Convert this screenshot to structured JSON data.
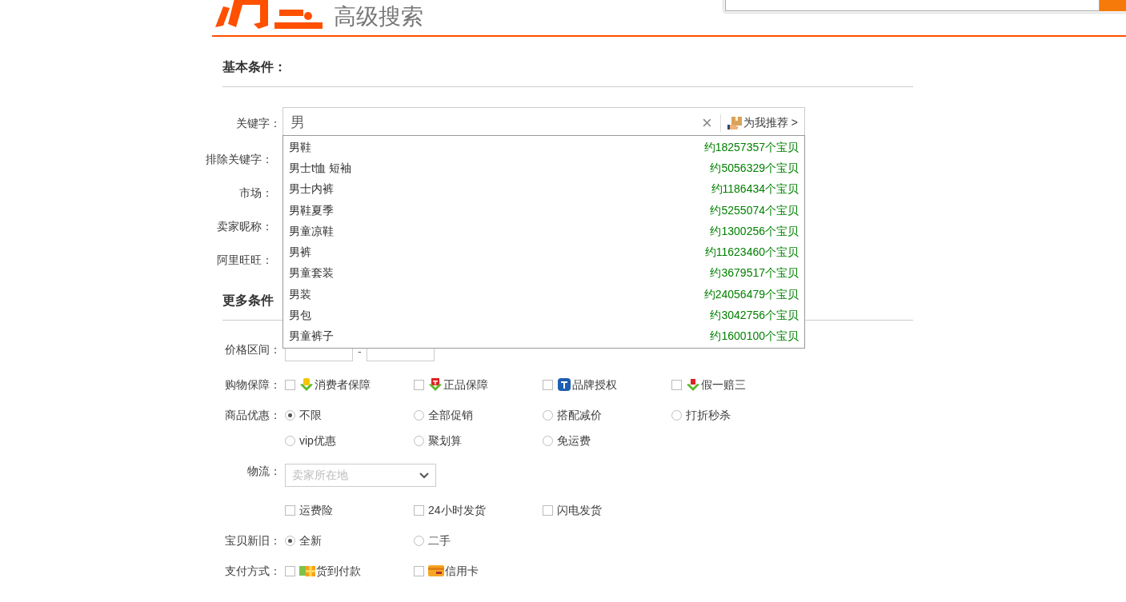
{
  "header": {
    "subtitle": "高级搜索"
  },
  "basic": {
    "title": "基本条件：",
    "keyword": {
      "label": "关键字：",
      "value": "男",
      "clear": "×",
      "recommend": "为我推荐 >"
    },
    "fields": [
      {
        "label": "排除关键字："
      },
      {
        "label": "市场："
      },
      {
        "label": "卖家昵称："
      },
      {
        "label": "阿里旺旺："
      }
    ]
  },
  "suggestions": [
    {
      "text": "男鞋",
      "count": "约18257357个宝贝"
    },
    {
      "text": "男士t恤 短袖",
      "count": "约5056329个宝贝"
    },
    {
      "text": "男士内裤",
      "count": "约1186434个宝贝"
    },
    {
      "text": "男鞋夏季",
      "count": "约5255074个宝贝"
    },
    {
      "text": "男童凉鞋",
      "count": "约1300256个宝贝"
    },
    {
      "text": "男裤",
      "count": "约11623460个宝贝"
    },
    {
      "text": "男童套装",
      "count": "约3679517个宝贝"
    },
    {
      "text": "男装",
      "count": "约24056479个宝贝"
    },
    {
      "text": "男包",
      "count": "约3042756个宝贝"
    },
    {
      "text": "男童裤子",
      "count": "约1600100个宝贝"
    }
  ],
  "more": {
    "title": "更多条件",
    "rows": [
      {
        "kind": "price",
        "label": "价格区间：",
        "separator": "-"
      },
      {
        "kind": "checkbox",
        "label": "购物保障：",
        "options": [
          {
            "text": "消费者保障",
            "checked": false,
            "kind": "shield"
          },
          {
            "text": "正品保障",
            "checked": false,
            "kind": "genuine"
          },
          {
            "text": "品牌授权",
            "checked": false,
            "kind": "brand"
          },
          {
            "text": "假一赔三",
            "checked": false,
            "kind": "real"
          }
        ]
      },
      {
        "kind": "radio",
        "label": "商品优惠：",
        "options": [
          {
            "text": "不限",
            "selected": true
          },
          {
            "text": "全部促销",
            "selected": false
          },
          {
            "text": "搭配减价",
            "selected": false
          },
          {
            "text": "打折秒杀",
            "selected": false
          },
          {
            "text": "vip优惠",
            "selected": false
          },
          {
            "text": "聚划算",
            "selected": false
          },
          {
            "text": "免运费",
            "selected": false
          }
        ]
      },
      {
        "kind": "select",
        "label": "物流：",
        "placeholder": "卖家所在地"
      },
      {
        "kind": "checkbox",
        "options": [
          {
            "text": "运费险",
            "checked": false
          },
          {
            "text": "24小时发货",
            "checked": false
          },
          {
            "text": "闪电发货",
            "checked": false
          }
        ]
      },
      {
        "kind": "radio",
        "label": "宝贝新旧：",
        "options": [
          {
            "text": "全新",
            "selected": true
          },
          {
            "text": "二手",
            "selected": false
          }
        ]
      },
      {
        "kind": "checkbox",
        "label": "支付方式：",
        "options": [
          {
            "text": "货到付款",
            "checked": false,
            "kind": "cod"
          },
          {
            "text": "信用卡",
            "checked": false,
            "kind": "card"
          }
        ]
      }
    ]
  }
}
